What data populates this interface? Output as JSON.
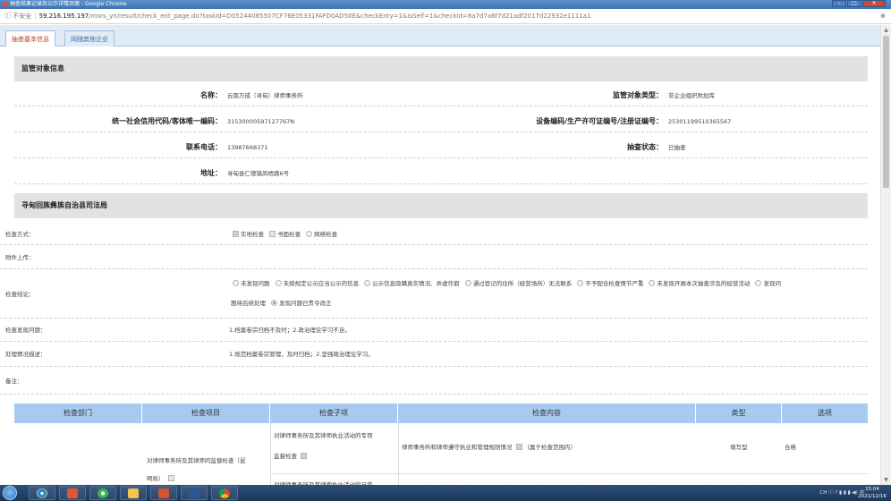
{
  "window": {
    "title": "抽查结果记录及公示详情页面 - Google Chrome"
  },
  "address": {
    "security": "不安全",
    "host": "59.216.195.197",
    "path": "/msrs_yn/result/check_ent_page.do?taskId=D05244085507CF76E05331FAFD0AD50E&checkEnty=1&isSelf=1&checkId=8a7d7a8f7d21adf2017d22932e1111a1"
  },
  "tabs": [
    {
      "label": "抽查基本信息",
      "active": true
    },
    {
      "label": "同随其他企业",
      "active": false
    }
  ],
  "supervised": {
    "header": "监管对象信息",
    "name_label": "名称：",
    "name_value": "云南万成（寻甸）律师事务所",
    "type_label": "监管对象类型：",
    "type_value": "非企业组织附加库",
    "code_label": "统一社会信用代码/客体唯一编码：",
    "code_value": "31530000597127767N",
    "device_label": "设备编码/生产许可证编号/注册证编号：",
    "device_value": "25301199510365567",
    "phone_label": "联系电话：",
    "phone_value": "13987668371",
    "status_label": "抽查状态：",
    "status_value": "已抽查",
    "addr_label": "地址：",
    "addr_value": "寻甸县仁德镇凤梧路6号"
  },
  "bureau": {
    "header": "寻甸回族彝族自治县司法局",
    "method_label": "检查方式：",
    "methods": [
      "实地检查",
      "书面检查",
      "网络检查"
    ],
    "attach_label": "附件上传：",
    "conclusion_label": "检查结论：",
    "conclusions_line1": [
      "未发现问题",
      "未按规定公示应当公示的信息",
      "公示信息隐瞒真实情况、弄虚作假",
      "通过登记的住所（经营场所）无法联系",
      "不予配合检查情节严重",
      "未发现开展本次抽查涉及的经营活动",
      "发现问"
    ],
    "conclusions_line2_prefix": "题待后续处理",
    "conclusions_line2_checked": "发现问题已责令改正",
    "problem_label": "检查发现问题：",
    "problem_value": "1.档案卷宗归档不及时；2.政治理论学习不足。",
    "handle_label": "处理情况描述：",
    "handle_value": "1.规范档案卷宗管理，及时归档；2.坚强政治理论学习。",
    "remark_label": "备注："
  },
  "table": {
    "headers": [
      "检查部门",
      "检查项目",
      "检查子项",
      "检查内容",
      "类型",
      "选项"
    ],
    "row1": {
      "item": "对律师事务所及其律师的监督检查（昆",
      "item_cont": "明局）",
      "subitem_line1": "对律师事务所及其律师执业活动的专项",
      "subitem_line2": "监督检查",
      "content": "律师事务所和律师遵守执业和管理规则情况",
      "content_note": "（属于检查范围内）",
      "type": "填写型",
      "option": "合格"
    },
    "row2": {
      "subitem_line1": "对律师事务所及其律师执业活动的日常"
    }
  },
  "taskbar": {
    "apps": [
      "ie-icon",
      "pdf-icon",
      "chrome360-icon",
      "folder-icon",
      "powerpoint-icon",
      "word-icon",
      "chrome-icon"
    ],
    "tray": "CH ⓘ ? ▮ ▮ ▮ ◀) 中",
    "time": "15:04",
    "date": "2021/12/16"
  }
}
